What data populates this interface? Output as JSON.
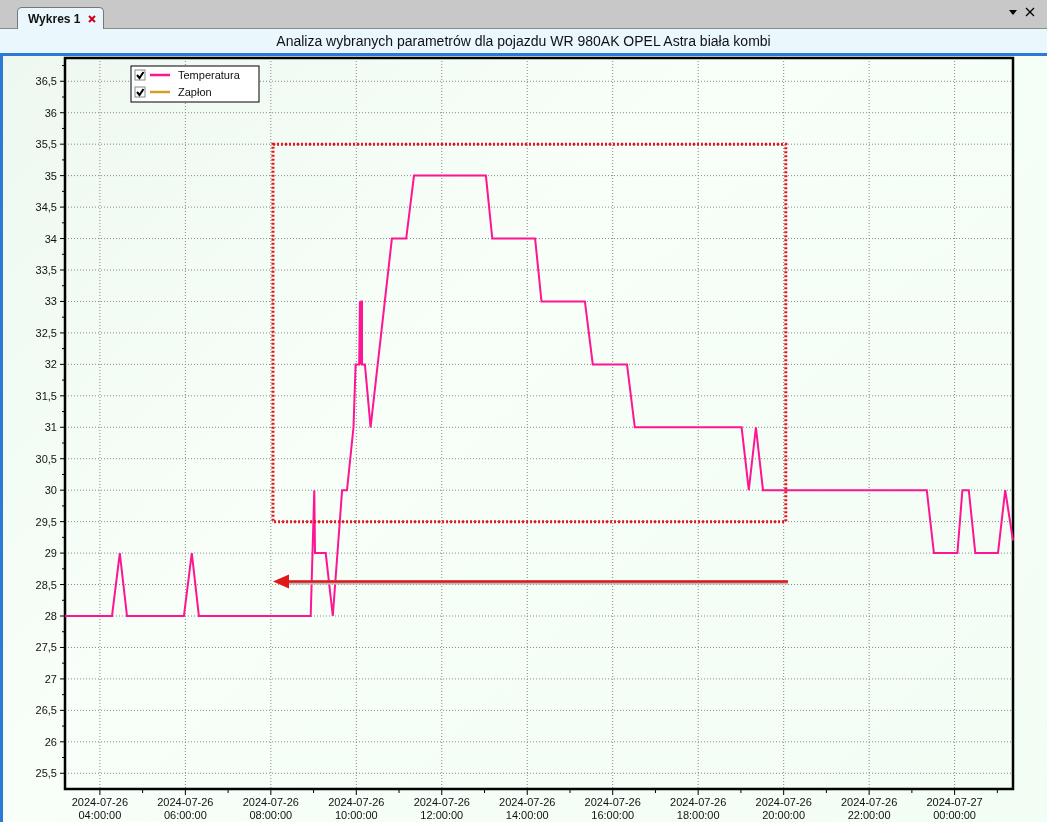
{
  "tabs": [
    {
      "label": "Wykres 1",
      "selected": true
    }
  ],
  "chart": {
    "title": "Analiza wybranych parametrów dla pojazdu WR 980AK OPEL Astra biała kombi",
    "legend": [
      {
        "checked": true
      },
      {
        "checked": true
      }
    ],
    "chart_data": {
      "type": "line",
      "grid": true,
      "x": [
        "2024-07-26 03:11",
        "2024-07-26 04:17",
        "2024-07-26 04:28",
        "2024-07-26 04:38",
        "2024-07-26 05:58",
        "2024-07-26 06:09",
        "2024-07-26 06:19",
        "2024-07-26 08:56",
        "2024-07-26 09:01",
        "2024-07-26 09:02",
        "2024-07-26 09:17",
        "2024-07-26 09:27",
        "2024-07-26 09:40",
        "2024-07-26 09:47",
        "2024-07-26 09:56",
        "2024-07-26 09:59",
        "2024-07-26 10:04",
        "2024-07-26 10:05",
        "2024-07-26 10:06",
        "2024-07-26 10:07",
        "2024-07-26 10:08",
        "2024-07-26 10:08",
        "2024-07-26 10:12",
        "2024-07-26 10:20",
        "2024-07-26 10:50",
        "2024-07-26 11:10",
        "2024-07-26 11:21",
        "2024-07-26 13:02",
        "2024-07-26 13:11",
        "2024-07-26 14:11",
        "2024-07-26 14:20",
        "2024-07-26 15:21",
        "2024-07-26 15:32",
        "2024-07-26 16:20",
        "2024-07-26 16:31",
        "2024-07-26 19:01",
        "2024-07-26 19:11",
        "2024-07-26 19:21",
        "2024-07-26 19:31",
        "2024-07-26 23:21",
        "2024-07-26 23:31",
        "2024-07-27 00:04",
        "2024-07-27 00:11",
        "2024-07-27 00:20",
        "2024-07-27 00:29",
        "2024-07-27 01:01",
        "2024-07-27 01:11",
        "2024-07-27 01:22"
      ],
      "series": [
        {
          "name": "Temperatura",
          "color": "#ff1493",
          "values": [
            28,
            28,
            29,
            28,
            28,
            29,
            28,
            28,
            30,
            29,
            29,
            28,
            30,
            30,
            31,
            32,
            32,
            33,
            32,
            33,
            33,
            32,
            32,
            31,
            34,
            34,
            35,
            35,
            34,
            34,
            33,
            33,
            32,
            32,
            31,
            31,
            30,
            31,
            30,
            30,
            29,
            29,
            30,
            30,
            29,
            29,
            30,
            29.2
          ]
        },
        {
          "name": "Zapłon",
          "color": "#d4a020",
          "values": [
            null,
            null,
            null,
            null,
            null,
            null,
            null,
            null,
            null,
            null,
            null,
            null,
            null,
            null,
            null,
            null,
            null,
            null,
            null,
            null,
            null,
            null,
            null,
            null,
            null,
            null,
            null,
            null,
            null,
            null,
            null,
            null,
            null,
            null,
            null,
            null,
            null,
            null,
            null,
            null,
            null,
            null,
            null,
            null,
            null,
            null,
            null,
            null
          ]
        }
      ],
      "xlim": [
        "2024-07-26 03:11",
        "2024-07-27 01:22"
      ],
      "ylim": [
        25.25,
        36.87
      ],
      "xticks": [
        "2024-07-26 04:00:00",
        "2024-07-26 06:00:00",
        "2024-07-26 08:00:00",
        "2024-07-26 10:00:00",
        "2024-07-26 12:00:00",
        "2024-07-26 14:00:00",
        "2024-07-26 16:00:00",
        "2024-07-26 18:00:00",
        "2024-07-26 20:00:00",
        "2024-07-26 22:00:00",
        "2024-07-27 00:00:00"
      ],
      "yticks": [
        {
          "value": 25.5,
          "label": "25,5"
        },
        {
          "value": 26,
          "label": "26"
        },
        {
          "value": 26.5,
          "label": "26,5"
        },
        {
          "value": 27,
          "label": "27"
        },
        {
          "value": 27.5,
          "label": "27,5"
        },
        {
          "value": 28,
          "label": "28"
        },
        {
          "value": 28.5,
          "label": "28,5"
        },
        {
          "value": 29,
          "label": "29"
        },
        {
          "value": 29.5,
          "label": "29,5"
        },
        {
          "value": 30,
          "label": "30"
        },
        {
          "value": 30.5,
          "label": "30,5"
        },
        {
          "value": 31,
          "label": "31"
        },
        {
          "value": 31.5,
          "label": "31,5"
        },
        {
          "value": 32,
          "label": "32"
        },
        {
          "value": 32.5,
          "label": "32,5"
        },
        {
          "value": 33,
          "label": "33"
        },
        {
          "value": 33.5,
          "label": "33,5"
        },
        {
          "value": 34,
          "label": "34"
        },
        {
          "value": 34.5,
          "label": "34,5"
        },
        {
          "value": 35,
          "label": "35"
        },
        {
          "value": 35.5,
          "label": "35,5"
        },
        {
          "value": 36,
          "label": "36"
        },
        {
          "value": 36.5,
          "label": "36,5"
        }
      ]
    }
  }
}
